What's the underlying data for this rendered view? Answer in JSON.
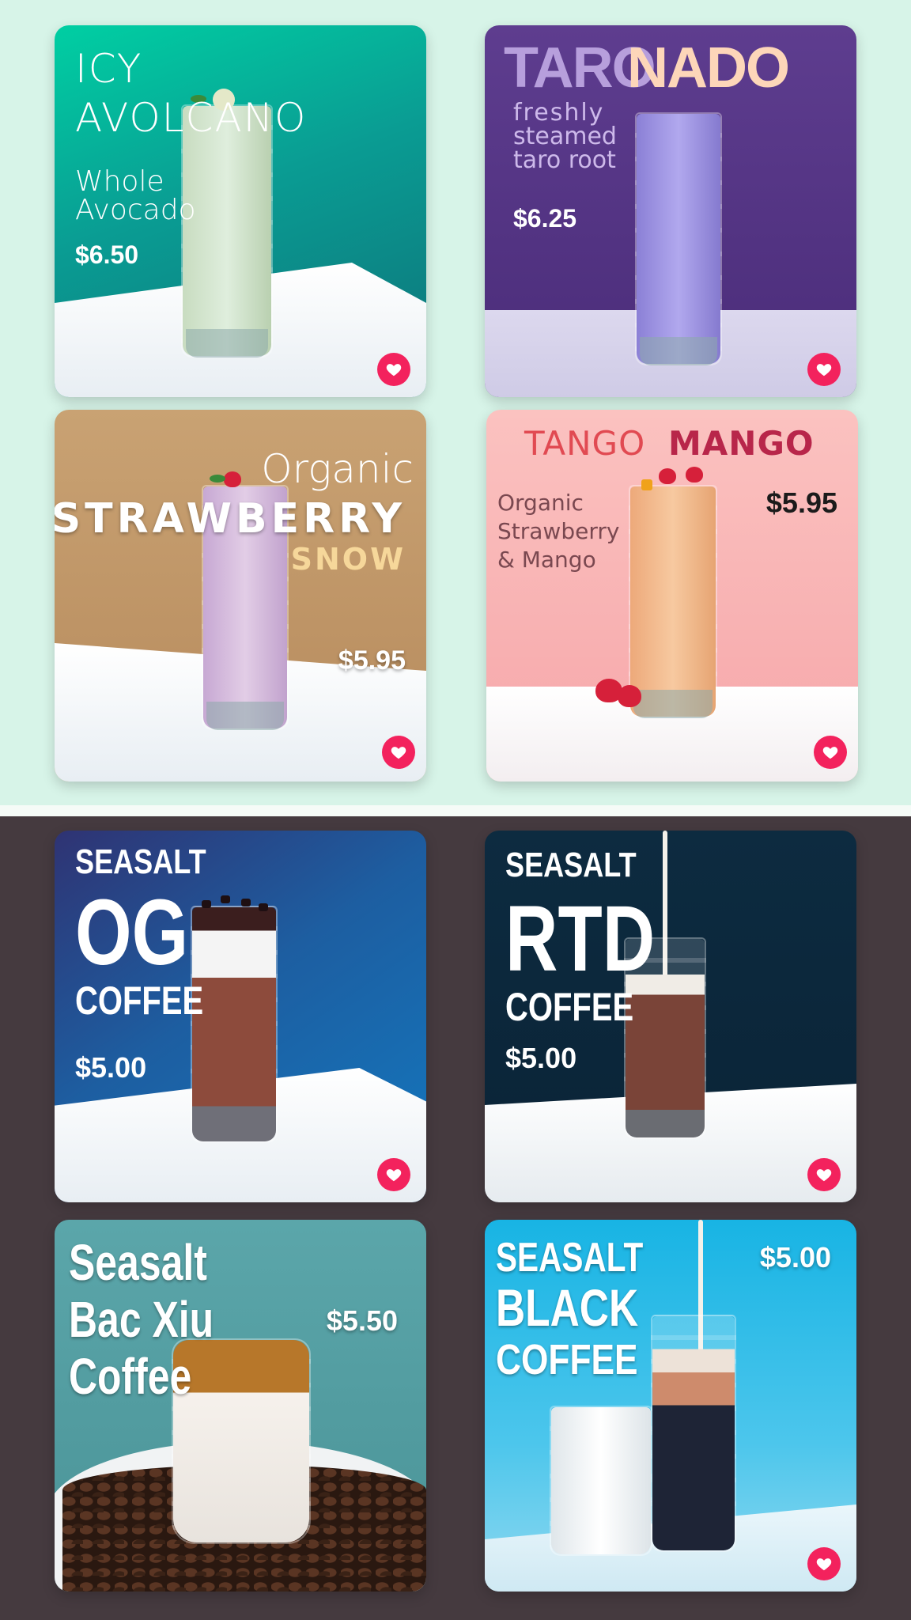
{
  "colors": {
    "drinks_background": "#d7f4e8",
    "coffee_background": "#453a3f",
    "favorite_button": "#f3225d"
  },
  "drinks": [
    {
      "name_lines": [
        "ICY",
        "AVOLCANO"
      ],
      "description_lines": [
        "Whole",
        "Avocado"
      ],
      "price": "$6.50",
      "favorite_icon": "heart-icon"
    },
    {
      "name_parts": [
        "TARO",
        "NADO"
      ],
      "description_lines": [
        "freshly",
        "steamed",
        "taro root"
      ],
      "price": "$6.25",
      "favorite_icon": "heart-icon"
    },
    {
      "name_lines": [
        "Organic",
        "STRAWBERRY",
        "SNOW"
      ],
      "price": "$5.95",
      "favorite_icon": "heart-icon"
    },
    {
      "name_parts": [
        "TANGO",
        "MANGO"
      ],
      "description_lines": [
        "Organic",
        "Strawberry",
        "& Mango"
      ],
      "price": "$5.95",
      "favorite_icon": "heart-icon"
    }
  ],
  "coffees": [
    {
      "name_lines": [
        "SEASALT",
        "OG",
        "COFFEE"
      ],
      "price": "$5.00",
      "favorite_icon": "heart-icon"
    },
    {
      "name_lines": [
        "SEASALT",
        "RTD",
        "COFFEE"
      ],
      "price": "$5.00",
      "favorite_icon": "heart-icon"
    },
    {
      "name_lines": [
        "Seasalt",
        "Bac Xiu",
        "Coffee"
      ],
      "price": "$5.50",
      "favorite_icon": "heart-icon"
    },
    {
      "name_lines": [
        "SEASALT",
        "BLACK",
        "COFFEE"
      ],
      "price": "$5.00",
      "favorite_icon": "heart-icon"
    }
  ]
}
